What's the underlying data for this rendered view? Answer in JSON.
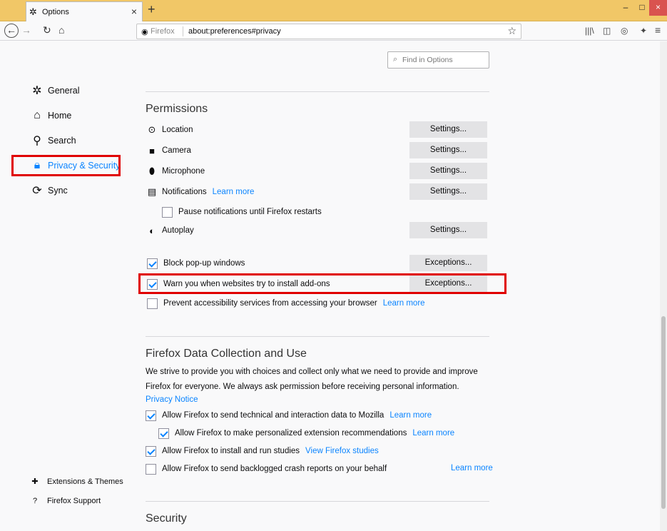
{
  "tab": {
    "title": "Options",
    "close": "×",
    "new_tab": "+"
  },
  "window": {
    "minimize": "–",
    "maximize": "□",
    "close": "×"
  },
  "nav": {
    "identity_label": "Firefox",
    "url": "about:preferences#privacy"
  },
  "find": {
    "placeholder": "Find in Options"
  },
  "sidebar": {
    "items": [
      {
        "label": "General"
      },
      {
        "label": "Home"
      },
      {
        "label": "Search"
      },
      {
        "label": "Privacy & Security"
      },
      {
        "label": "Sync"
      }
    ],
    "footer": [
      {
        "label": "Extensions & Themes"
      },
      {
        "label": "Firefox Support"
      }
    ]
  },
  "permissions": {
    "heading": "Permissions",
    "rows": [
      {
        "label": "Location",
        "button": "Settings..."
      },
      {
        "label": "Camera",
        "button": "Settings..."
      },
      {
        "label": "Microphone",
        "button": "Settings..."
      },
      {
        "label": "Notifications",
        "link": "Learn more",
        "button": "Settings..."
      },
      {
        "label": "Autoplay",
        "button": "Settings..."
      }
    ],
    "pause_notifications": {
      "label": "Pause notifications until Firefox restarts",
      "checked": false
    },
    "block_popups": {
      "label": "Block pop-up windows",
      "checked": true,
      "button": "Exceptions..."
    },
    "warn_addons": {
      "label": "Warn you when websites try to install add-ons",
      "checked": true,
      "button": "Exceptions..."
    },
    "prevent_accessibility": {
      "label": "Prevent accessibility services from accessing your browser",
      "link": "Learn more",
      "checked": false
    }
  },
  "data_collection": {
    "heading": "Firefox Data Collection and Use",
    "description_line1": "We strive to provide you with choices and collect only what we need to provide and improve",
    "description_line2": "Firefox for everyone. We always ask permission before receiving personal information.",
    "privacy_notice": "Privacy Notice",
    "options": [
      {
        "label": "Allow Firefox to send technical and interaction data to Mozilla",
        "link": "Learn more",
        "checked": true
      },
      {
        "label": "Allow Firefox to make personalized extension recommendations",
        "link": "Learn more",
        "checked": true
      },
      {
        "label": "Allow Firefox to install and run studies",
        "link": "View Firefox studies",
        "checked": true
      },
      {
        "label": "Allow Firefox to send backlogged crash reports on your behalf",
        "link": "Learn more",
        "checked": false
      }
    ]
  },
  "security": {
    "heading": "Security"
  },
  "colors": {
    "accent": "#0a84ff",
    "highlight": "#e00000",
    "titlebar": "#f1c767"
  }
}
